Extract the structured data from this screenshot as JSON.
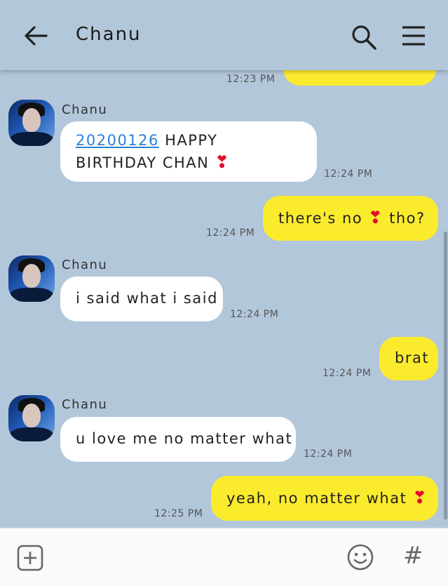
{
  "header": {
    "title": "Chanu"
  },
  "messages": [
    {
      "dir": "out",
      "text": "",
      "time": "12:23 PM"
    },
    {
      "dir": "in",
      "sender": "Chanu",
      "link": "20200126",
      "text": "HAPPY BIRTHDAY CHAN",
      "time": "12:24 PM"
    },
    {
      "dir": "out",
      "text_before": "there's no",
      "text_after": "tho?",
      "time": "12:24 PM"
    },
    {
      "dir": "in",
      "sender": "Chanu",
      "text": "i said what i said",
      "time": "12:24 PM"
    },
    {
      "dir": "out",
      "text": "brat",
      "time": "12:24 PM"
    },
    {
      "dir": "in",
      "sender": "Chanu",
      "text": "u love me no matter what",
      "time": "12:24 PM"
    },
    {
      "dir": "out",
      "text": "yeah, no matter what",
      "time": "12:25 PM"
    }
  ],
  "icons": {
    "back": "back-arrow-icon",
    "search": "search-icon",
    "menu": "hamburger-menu-icon",
    "attach": "plus-square-icon",
    "emoji": "emoji-icon",
    "hashtag": "hashtag-icon",
    "heart": "heart-emoji"
  },
  "colors": {
    "background": "#b2c7da",
    "incoming_bubble": "#ffffff",
    "outgoing_bubble": "#fbeb2d",
    "link": "#2a7fd6",
    "heart": "#e0102d"
  }
}
